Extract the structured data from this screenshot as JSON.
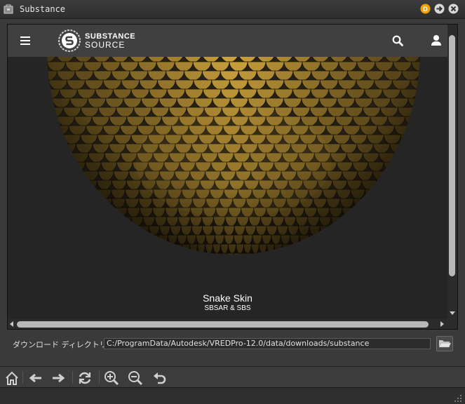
{
  "window": {
    "title": "Substance",
    "icon": "bag-icon",
    "controls": [
      "d-badge-icon",
      "forward-circle-icon",
      "close-circle-icon"
    ]
  },
  "site": {
    "brand_line1": "SUBSTANCE",
    "brand_line2": "SOURCE",
    "icons": [
      "hamburger-menu-icon",
      "substance-logo-icon",
      "search-icon",
      "user-icon"
    ]
  },
  "product": {
    "name": "Snake Skin",
    "formats": "SBSAR & SBS"
  },
  "download": {
    "label": "ダウンロード ディレクトリ(D)",
    "path": "C:/ProgramData/Autodesk/VREDPro-12.0/data/downloads/substance",
    "browse_icon": "folder-open-icon"
  },
  "toolbar": {
    "tools": [
      "home-icon",
      "back-arrow-icon",
      "forward-arrow-icon",
      "refresh-icon",
      "zoom-in-icon",
      "zoom-out-icon",
      "undo-icon"
    ]
  },
  "colors": {
    "accent_orange": "#f0a000",
    "scale_gold": "#c99a3a",
    "background_dark": "#252525",
    "header_gray": "#404040"
  }
}
